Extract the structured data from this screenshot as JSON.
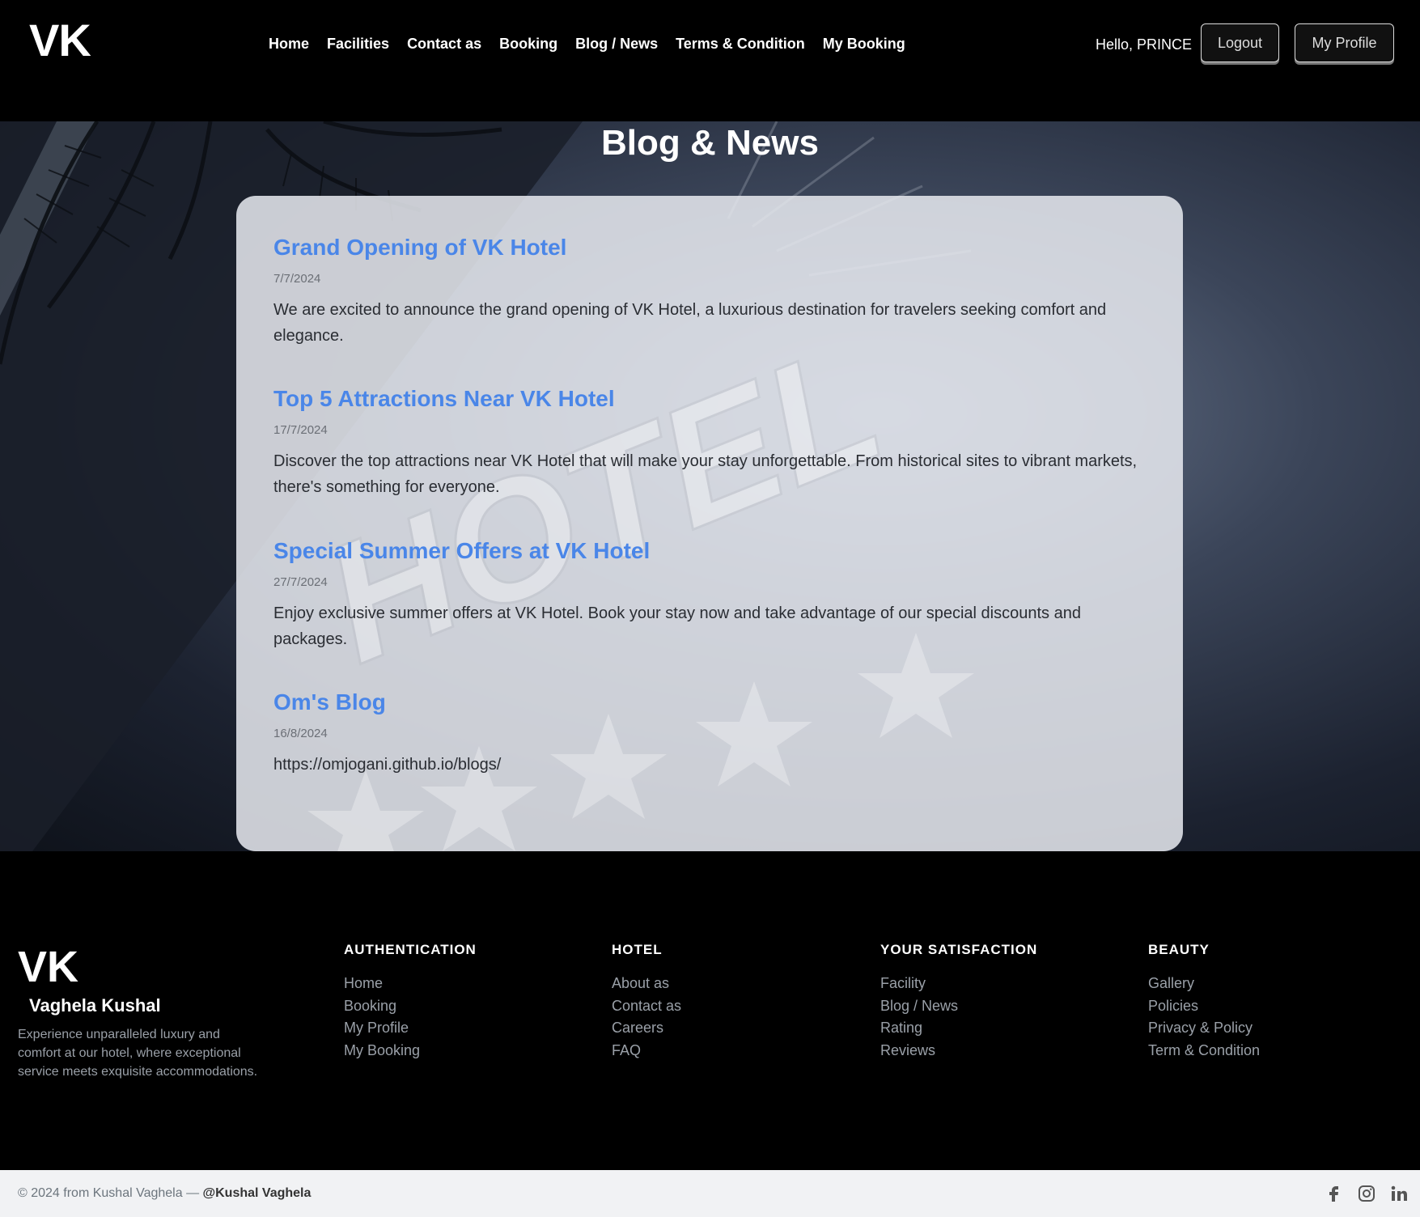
{
  "header": {
    "logo": "VK",
    "nav": [
      "Home",
      "Facilities",
      "Contact as",
      "Booking",
      "Blog / News",
      "Terms & Condition",
      "My Booking"
    ],
    "greeting": "Hello, PRINCE",
    "logout_label": "Logout",
    "profile_label": "My Profile"
  },
  "hero": {
    "title": "Blog & News",
    "background_sign": "HOTEL"
  },
  "posts": [
    {
      "title": "Grand Opening of VK Hotel",
      "date": "7/7/2024",
      "body": "We are excited to announce the grand opening of VK Hotel, a luxurious destination for travelers seeking comfort and elegance."
    },
    {
      "title": "Top 5 Attractions Near VK Hotel",
      "date": "17/7/2024",
      "body": "Discover the top attractions near VK Hotel that will make your stay unforgettable. From historical sites to vibrant markets, there's something for everyone."
    },
    {
      "title": "Special Summer Offers at VK Hotel",
      "date": "27/7/2024",
      "body": "Enjoy exclusive summer offers at VK Hotel. Book your stay now and take advantage of our special discounts and packages."
    },
    {
      "title": "Om's Blog",
      "date": "16/8/2024",
      "body": "https://omjogani.github.io/blogs/"
    }
  ],
  "footer": {
    "logo": "VK",
    "name": "Vaghela Kushal",
    "description": "Experience unparalleled luxury and comfort at our hotel, where exceptional service meets exquisite accommodations.",
    "columns": [
      {
        "heading": "AUTHENTICATION",
        "links": [
          "Home",
          "Booking",
          "My Profile",
          "My Booking"
        ]
      },
      {
        "heading": "HOTEL",
        "links": [
          "About as",
          "Contact as",
          "Careers",
          "FAQ"
        ]
      },
      {
        "heading": "YOUR SATISFACTION",
        "links": [
          "Facility",
          "Blog / News",
          "Rating",
          "Reviews"
        ]
      },
      {
        "heading": "BEAUTY",
        "links": [
          "Gallery",
          "Policies",
          "Privacy & Policy",
          "Term & Condition"
        ]
      }
    ],
    "copyright_prefix": "© 2024 from Kushal Vaghela — ",
    "copyright_handle": "@Kushal Vaghela",
    "social_icons": [
      "facebook-icon",
      "instagram-icon",
      "linkedin-icon"
    ]
  },
  "colors": {
    "link_blue": "#4a86e8",
    "header_bg": "#000000",
    "card_bg": "#e8eaf0"
  }
}
